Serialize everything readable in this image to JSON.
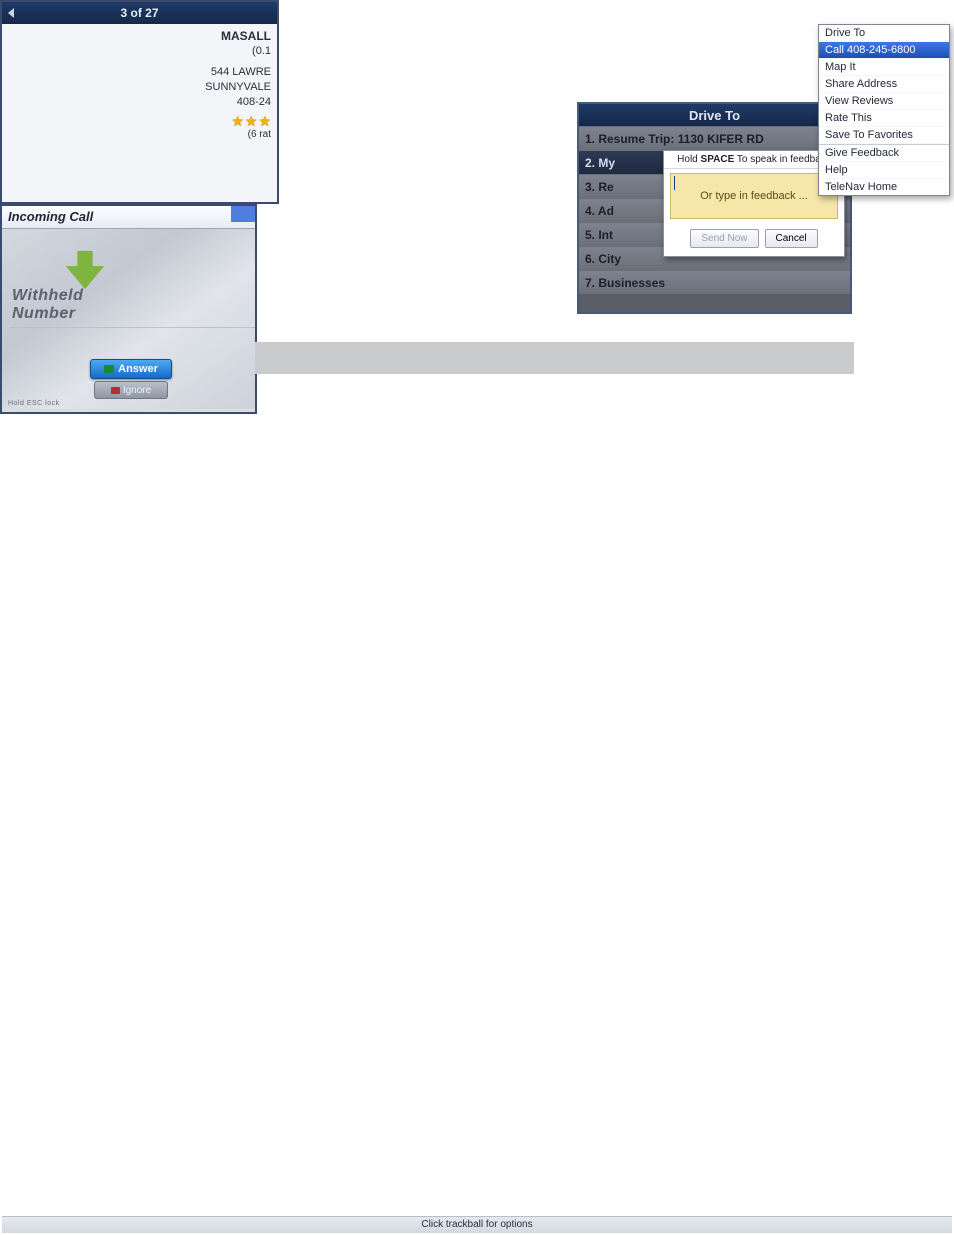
{
  "shot1": {
    "title": "Drive To",
    "rows": [
      "1. Resume Trip: 1130 KIFER RD",
      "2. My",
      "3. Re",
      "4. Ad",
      "5. Int",
      "6. City",
      "7. Businesses"
    ],
    "selected_index": 1,
    "feedback": {
      "tip_prefix": "Hold ",
      "tip_bold": "SPACE",
      "tip_suffix": " To speak in feedback",
      "placeholder": "Or type in feedback ...",
      "send_label": "Send Now",
      "cancel_label": "Cancel"
    }
  },
  "shot2": {
    "counter": "3 of 27",
    "name": "MASALL",
    "dist": "(0.1",
    "addr1": "544 LAWRE",
    "addr2": "SUNNYVALE",
    "phone": "408-24",
    "ratings_line": "(6 rat",
    "footer": "Click trackball for options",
    "menu": [
      "Drive To",
      "Call 408-245-6800",
      "Map It",
      "Share Address",
      "View Reviews",
      "Rate This",
      "Save To Favorites",
      "Give Feedback",
      "Help",
      "TeleNav Home"
    ],
    "menu_selected_index": 1,
    "menu_dividers_after": [
      6
    ]
  },
  "shot3": {
    "title": "Incoming Call",
    "caller": "Withheld Number",
    "answer_label": "Answer",
    "ignore_label": "Ignore",
    "tiny_label": "Hold ESC lock"
  }
}
